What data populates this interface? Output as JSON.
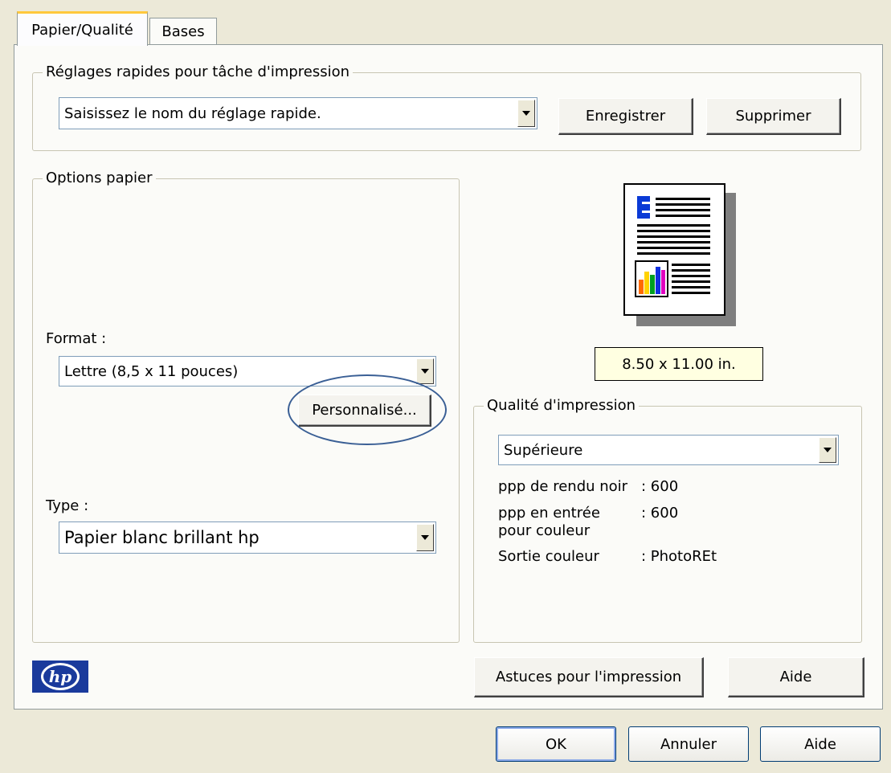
{
  "tabs": [
    {
      "label": "Papier/Qualité",
      "active": true
    },
    {
      "label": "Bases",
      "active": false
    }
  ],
  "quick_settings": {
    "legend": "Réglages rapides pour tâche d'impression",
    "combo_value": "Saisissez le nom du réglage rapide.",
    "save_label": "Enregistrer",
    "delete_label": "Supprimer"
  },
  "paper_options": {
    "legend": "Options papier",
    "format_label": "Format :",
    "format_value": "Lettre (8,5 x 11 pouces)",
    "custom_label": "Personnalisé...",
    "type_label": "Type :",
    "type_value": "Papier blanc brillant hp"
  },
  "preview": {
    "dimensions": "8.50 x 11.00 in."
  },
  "print_quality": {
    "legend": "Qualité d'impression",
    "combo_value": "Supérieure",
    "black_dpi_label": "ppp de rendu noir",
    "black_dpi_value": ": 600",
    "color_dpi_label": "ppp en entrée pour couleur",
    "color_dpi_value": ": 600",
    "color_out_label": "Sortie couleur",
    "color_out_value": ": PhotoREt"
  },
  "panel_buttons": {
    "tips_label": "Astuces pour l'impression",
    "help_label": "Aide"
  },
  "dialog_buttons": {
    "ok_label": "OK",
    "cancel_label": "Annuler",
    "help_label": "Aide"
  },
  "colors": {
    "hp_logo": "#1a3a9c",
    "default_button_focus": "#003c74",
    "dims_background": "#ffffe1"
  }
}
